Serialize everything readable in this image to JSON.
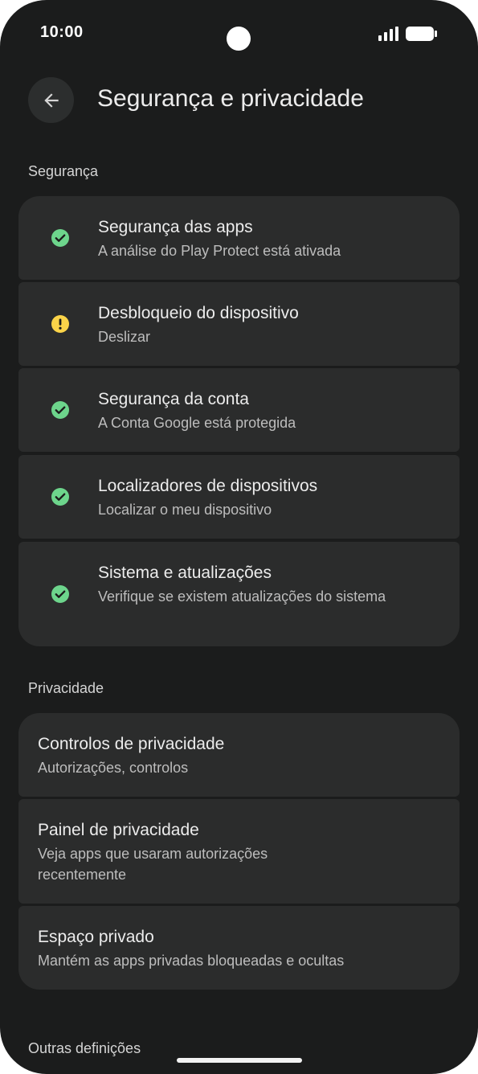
{
  "status_bar": {
    "time": "10:00"
  },
  "header": {
    "title": "Segurança e privacidade",
    "back_icon": "arrow-back-icon"
  },
  "sections": {
    "security": {
      "label": "Segurança",
      "items": [
        {
          "title": "Segurança das apps",
          "subtitle": "A análise do Play Protect está ativada",
          "status": "ok"
        },
        {
          "title": "Desbloqueio do dispositivo",
          "subtitle": "Deslizar",
          "status": "warning"
        },
        {
          "title": "Segurança da conta",
          "subtitle": "A Conta Google está protegida",
          "status": "ok"
        },
        {
          "title": "Localizadores de dispositivos",
          "subtitle": "Localizar o meu dispositivo",
          "status": "ok"
        },
        {
          "title": "Sistema e atualizações",
          "subtitle": "Verifique se existem atualizações do sistema",
          "status": "ok"
        }
      ]
    },
    "privacy": {
      "label": "Privacidade",
      "items": [
        {
          "title": "Controlos de privacidade",
          "subtitle": "Autorizações, controlos"
        },
        {
          "title": "Painel de privacidade",
          "subtitle": "Veja apps que usaram autorizações recentemente"
        },
        {
          "title": "Espaço privado",
          "subtitle": "Mantém as apps privadas bloqueadas e ocultas"
        }
      ]
    },
    "other": {
      "label": "Outras definições"
    }
  },
  "colors": {
    "background": "#1b1c1c",
    "card": "#2b2c2c",
    "ok_green": "#6dd58c",
    "warning_yellow": "#fbd449"
  }
}
